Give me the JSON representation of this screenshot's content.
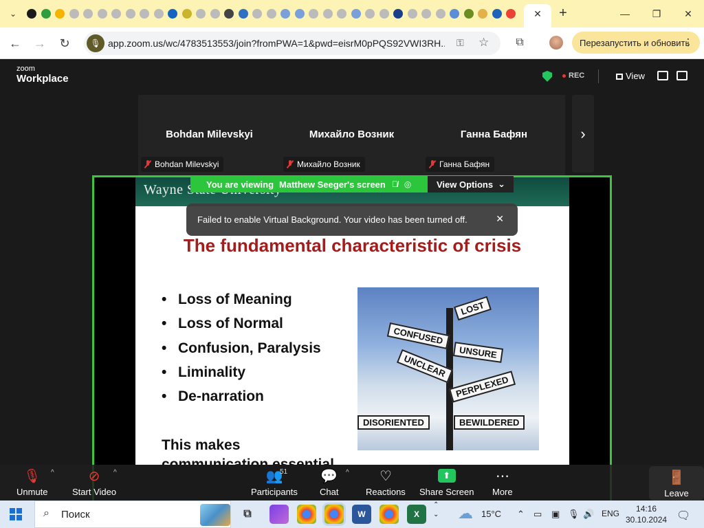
{
  "browser": {
    "url": "app.zoom.us/wc/4783513553/join?fromPWA=1&pwd=eisrM0pPQS92VWI3RH...",
    "relaunch_label": "Перезапустить и обновить",
    "tab_close": "✕",
    "new_tab": "+",
    "pinned_tab_colors": [
      "#1a1a1a",
      "#2e9e3f",
      "#f4b400",
      "#bbbbbb",
      "#bbbbbb",
      "#bbbbbb",
      "#bbbbbb",
      "#bbbbbb",
      "#bbbbbb",
      "#bbbbbb",
      "#1565c0",
      "#c9b42a",
      "#bbbbbb",
      "#bbbbbb",
      "#444444",
      "#2f6fc4",
      "#bbbbbb",
      "#bbbbbb",
      "#7aa0d9",
      "#7aa0d9",
      "#bbbbbb",
      "#bbbbbb",
      "#bbbbbb",
      "#7aa0d9",
      "#bbbbbb",
      "#bbbbbb",
      "#1b3e8a",
      "#bbbbbb",
      "#bbbbbb",
      "#bbbbbb",
      "#5a8fd8",
      "#6b8e23",
      "#e3b04a",
      "#1e63b8",
      "#ea4335"
    ]
  },
  "zoom": {
    "logo_top": "zoom",
    "logo_bottom": "Workplace",
    "rec_label": "REC",
    "view_label": "View",
    "participants_strip": [
      {
        "name": "Bohdan Milevskyi",
        "tag": "Bohdan Milevskyi"
      },
      {
        "name": "Михайло Возник",
        "tag": "Михайло Возник"
      },
      {
        "name": "Ганна Бафян",
        "tag": "Ганна Бафян"
      }
    ],
    "viewing_prefix": "You are viewing",
    "viewing_name": "Matthew Seeger's screen",
    "view_options": "View Options",
    "toast": "Failed to enable Virtual Background. Your video has been turned off.",
    "footer": {
      "unmute": "Unmute",
      "start_video": "Start Video",
      "participants": "Participants",
      "participants_count": "51",
      "chat": "Chat",
      "reactions": "Reactions",
      "share_screen": "Share Screen",
      "more": "More",
      "leave": "Leave"
    }
  },
  "slide": {
    "university": "Wayne State University",
    "title": "The fundamental characteristic of crisis",
    "bullets": [
      "Loss of Meaning",
      "Loss of Normal",
      "Confusion, Paralysis",
      "Liminality",
      "De-narration"
    ],
    "footer_line1": "This makes",
    "footer_line2": "communication essential",
    "signs": [
      "LOST",
      "CONFUSED",
      "UNSURE",
      "UNCLEAR",
      "PERPLEXED",
      "DISORIENTED",
      "BEWILDERED"
    ]
  },
  "taskbar": {
    "search_placeholder": "Поиск",
    "temperature": "15°C",
    "language": "ENG",
    "time": "14:16",
    "date": "30.10.2024"
  }
}
